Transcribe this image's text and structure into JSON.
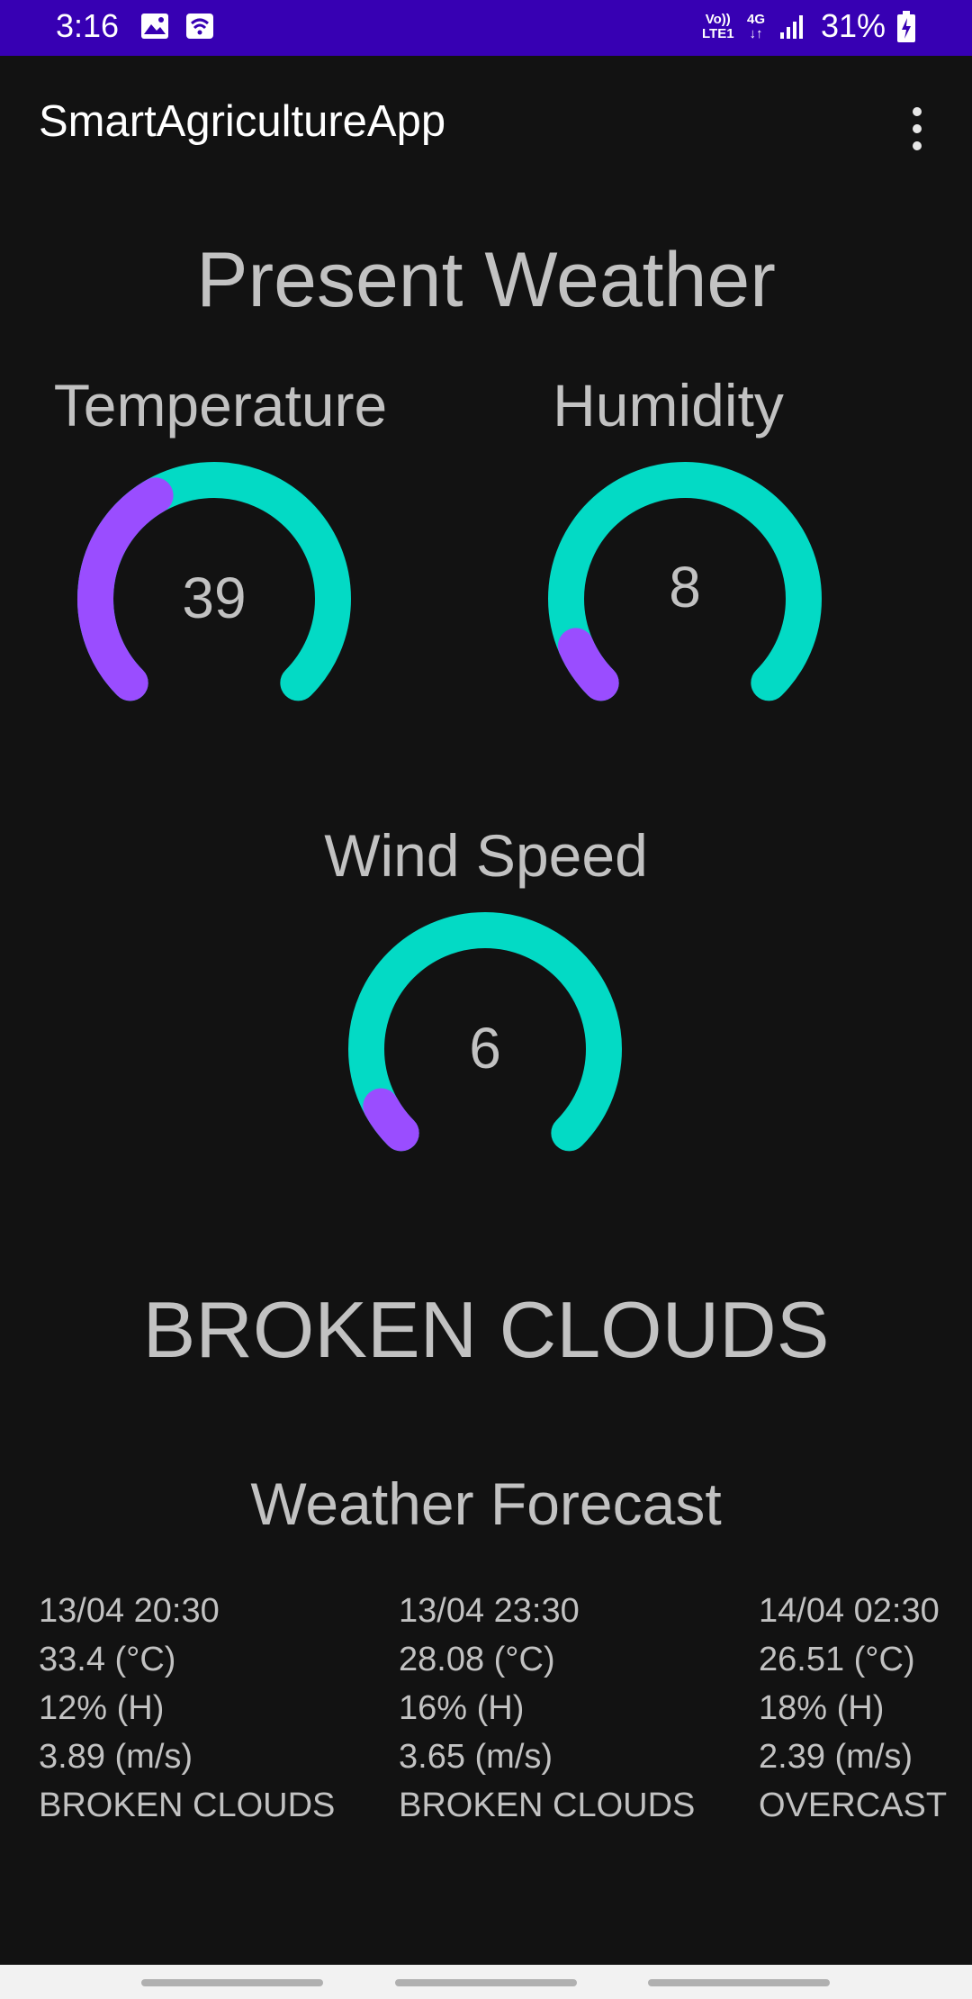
{
  "status_bar": {
    "time": "3:16",
    "volte": "Vo))",
    "lte": "LTE1",
    "network": "4G",
    "battery": "31%",
    "icons": [
      "image-icon",
      "wifi-hotspot-icon",
      "signal-icon",
      "battery-charging-icon"
    ]
  },
  "app_bar": {
    "title": "SmartAgricultureApp",
    "menu_icon": "more-vert-icon"
  },
  "present": {
    "title": "Present Weather",
    "gauges": [
      {
        "label": "Temperature",
        "value": "39",
        "fraction": 0.39
      },
      {
        "label": "Humidity",
        "value": "8",
        "fraction": 0.08
      },
      {
        "label": "Wind Speed",
        "value": "6",
        "fraction": 0.06
      }
    ],
    "condition": "BROKEN CLOUDS"
  },
  "forecast": {
    "title": "Weather Forecast",
    "items": [
      {
        "datetime": "13/04 20:30",
        "temp": "33.4 (°C)",
        "humidity": "12% (H)",
        "wind": "3.89 (m/s)",
        "desc": "BROKEN CLOUDS"
      },
      {
        "datetime": "13/04 23:30",
        "temp": "28.08 (°C)",
        "humidity": "16% (H)",
        "wind": "3.65 (m/s)",
        "desc": "BROKEN CLOUDS"
      },
      {
        "datetime": "14/04 02:30",
        "temp": "26.51 (°C)",
        "humidity": "18% (H)",
        "wind": "2.39 (m/s)",
        "desc": "OVERCAST"
      }
    ]
  },
  "colors": {
    "status_bar": "#3700b3",
    "background": "#121212",
    "gauge_track": "#03dac5",
    "gauge_progress": "#9a4dff"
  }
}
